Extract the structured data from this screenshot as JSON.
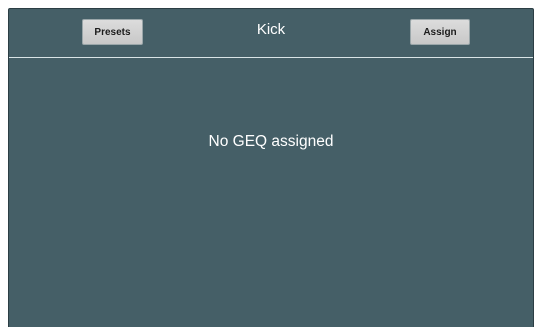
{
  "header": {
    "title": "Kick",
    "presets_label": "Presets",
    "assign_label": "Assign"
  },
  "main": {
    "message": "No GEQ assigned"
  },
  "colors": {
    "panel_background": "#455f67",
    "button_background": "#d4d4d4",
    "text": "#ffffff"
  }
}
